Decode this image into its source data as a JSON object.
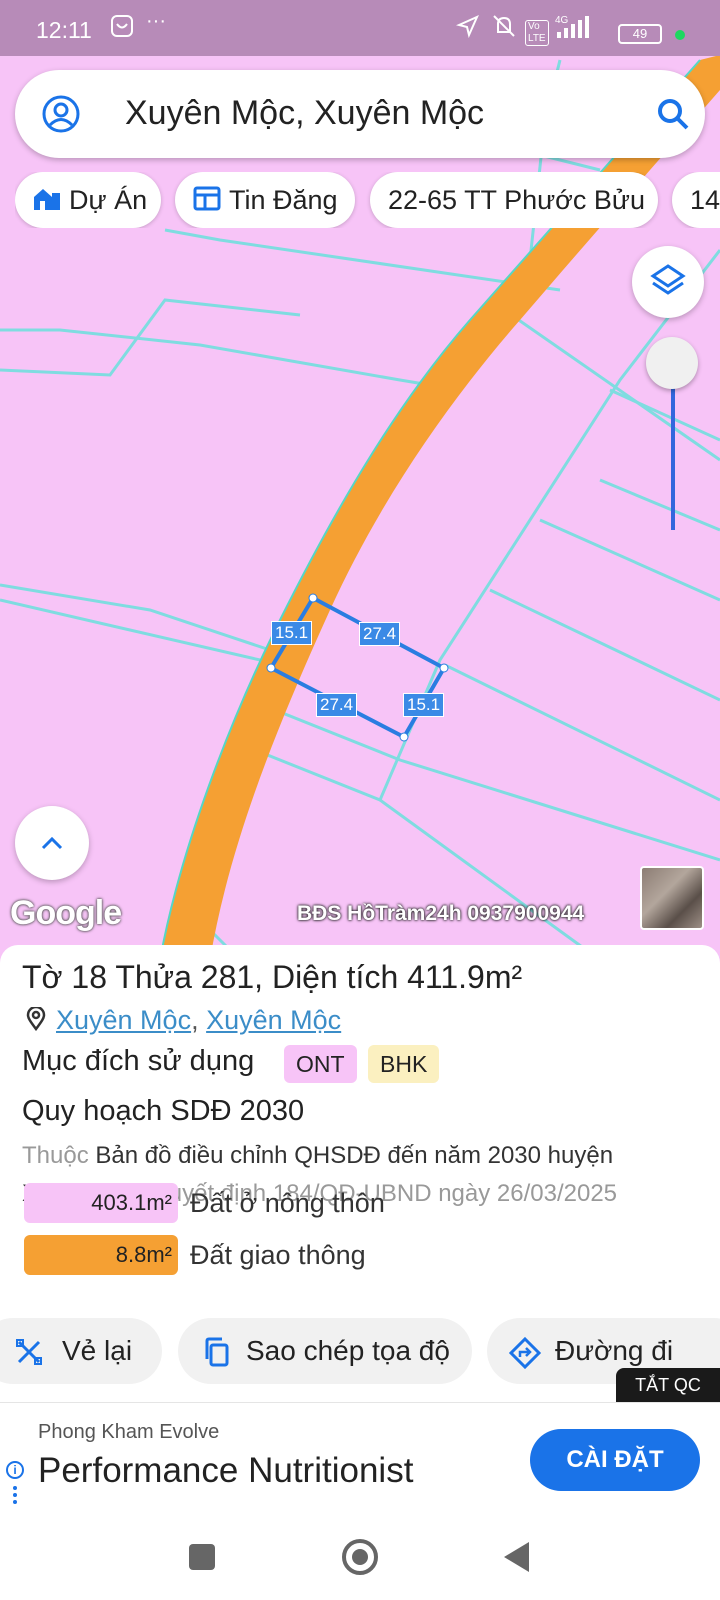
{
  "status_bar": {
    "time": "12:11",
    "battery": "49"
  },
  "search": {
    "text": "Xuyên Mộc, Xuyên Mộc"
  },
  "chips": [
    {
      "label": "Dự Án",
      "icon": "home-building-icon"
    },
    {
      "label": "Tin Đăng",
      "icon": "listing-icon"
    },
    {
      "label": "22-65 TT Phước Bửu"
    },
    {
      "label": "14"
    }
  ],
  "map": {
    "dimensions": [
      "15.1",
      "27.4",
      "27.4",
      "15.1"
    ],
    "google_logo": "Google",
    "watermark": "BĐS HồTràm24h 0937900944",
    "colors": {
      "residential": "#f7c4f7",
      "road": "#f5a033",
      "parcel_outline": "#2a7de1"
    }
  },
  "parcel": {
    "title_prefix": "Tờ",
    "sheet_no": "18",
    "plot_prefix": "Thửa",
    "plot_no": "281,",
    "area_prefix": "Diện tích",
    "area": "411.9m²",
    "location_1": "Xuyên Mộc",
    "location_sep": ",",
    "location_2": "Xuyên Mộc",
    "purpose_label": "Mục đích sử dụng",
    "purpose_tags": [
      {
        "code": "ONT",
        "color": "#f7c4f7"
      },
      {
        "code": "BHK",
        "color": "#fbf0c0"
      }
    ],
    "plan_title": "Quy hoạch SDĐ 2030",
    "desc_1": "Thuộc",
    "desc_2": "Bản đồ điều chỉnh QHSDĐ đến năm 2030 huyện Xuyên Mộc",
    "desc_3": ", quyết định 184/QĐ-UBND ngày 26/03/2025",
    "land_use": [
      {
        "area": "403.1m²",
        "label": "Đất ở nông thôn",
        "color": "#f7c4f7"
      },
      {
        "area": "8.8m²",
        "label": "Đất giao thông",
        "color": "#f5a033"
      }
    ]
  },
  "actions": {
    "redraw": "Vẻ lại",
    "copy_coords": "Sao chép tọa độ",
    "directions": "Đường đi"
  },
  "ad": {
    "close_label": "TẮT QC",
    "advertiser": "Phong Kham Evolve",
    "headline": "Performance Nutritionist",
    "cta": "CÀI ĐẶT"
  }
}
